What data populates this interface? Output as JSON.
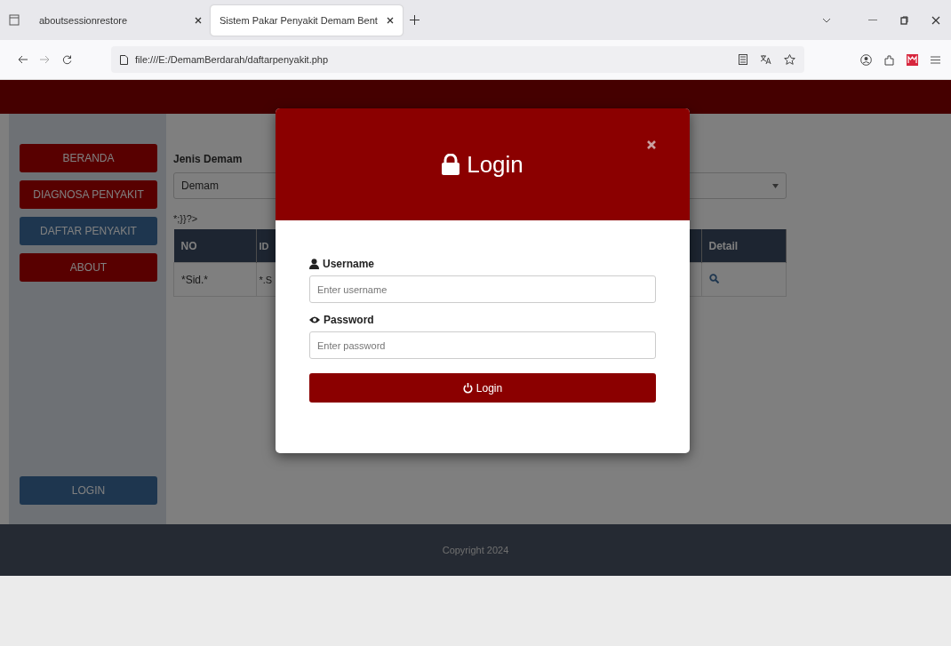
{
  "browser": {
    "tabs": [
      {
        "title": "aboutsessionrestore",
        "selected": false
      },
      {
        "title": "Sistem Pakar Penyakit Demam Bent",
        "selected": true
      }
    ],
    "address": "file:///E:/DemamBerdarah/daftarpenyakit.php"
  },
  "sidebar": {
    "items": [
      {
        "label": "BERANDA",
        "selected": false
      },
      {
        "label": "DIAGNOSA PENYAKIT",
        "selected": false
      },
      {
        "label": "DAFTAR PENYAKIT",
        "selected": true
      },
      {
        "label": "ABOUT",
        "selected": false
      }
    ],
    "login_button": "LOGIN"
  },
  "content": {
    "select_label": "Jenis Demam",
    "select_value": "Demam",
    "stray_text": "*;}}?>",
    "table": {
      "columns": [
        "NO",
        "ID",
        "Detail"
      ],
      "rows": [
        [
          "*Sid.*",
          "*.S"
        ]
      ]
    }
  },
  "footer": "Copyright 2024",
  "modal": {
    "title": "Login",
    "fields": [
      {
        "label": "Username",
        "placeholder": "Enter username",
        "kind": "user"
      },
      {
        "label": "Password",
        "placeholder": "Enter password",
        "kind": "eye"
      }
    ],
    "button": "Login"
  }
}
